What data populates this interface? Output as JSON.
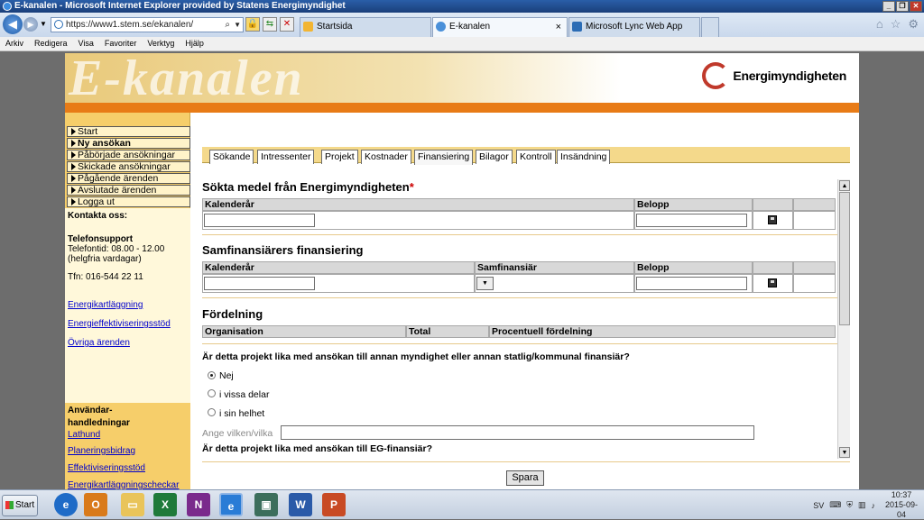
{
  "window": {
    "title": "E-kanalen - Microsoft Internet Explorer provided by Statens Energimyndighet",
    "min": "_",
    "restore": "❐",
    "close": "✕"
  },
  "browser": {
    "address": "https://www1.stem.se/ekanalen/",
    "tabs": [
      {
        "label": "Startsida"
      },
      {
        "label": "E-kanalen",
        "close": "×"
      },
      {
        "label": "Microsoft Lync Web App"
      }
    ],
    "menu": [
      "Arkiv",
      "Redigera",
      "Visa",
      "Favoriter",
      "Verktyg",
      "Hjälp"
    ]
  },
  "site": {
    "banner_title": "E-kanalen",
    "logo_text": "Energimyndigheten"
  },
  "sidebar": {
    "nav": [
      {
        "label": "Start",
        "bold": false
      },
      {
        "label": "Ny ansökan",
        "bold": true
      },
      {
        "label": "Påbörjade ansökningar",
        "bold": false
      },
      {
        "label": "Skickade ansökningar",
        "bold": false
      },
      {
        "label": "Pågående ärenden",
        "bold": false
      },
      {
        "label": "Avslutade ärenden",
        "bold": false
      },
      {
        "label": "Logga ut",
        "bold": false
      }
    ],
    "contact_title": "Kontakta oss:",
    "support_title": "Telefonsupport",
    "support_hours_1": "Telefontid: 08.00 - 12.00",
    "support_hours_2": "(helgfria vardagar)",
    "phone": "Tfn: 016-544 22 11",
    "links": [
      "Energikartläggning",
      "Energieffektiviseringsstöd",
      "Övriga ärenden"
    ],
    "manuals_title_1": "Användar-",
    "manuals_title_2": "handledningar",
    "manuals": [
      "Lathund",
      "Planeringsbidrag",
      "Effektiviseringsstöd",
      "Energikartläggningscheckar"
    ]
  },
  "tabs": [
    "Sökande",
    "Intressenter",
    "Projekt",
    "Kostnader",
    "Finansiering",
    "Bilagor",
    "Kontroll",
    "Insändning"
  ],
  "active_tab": "Finansiering",
  "form": {
    "section1": {
      "title": "Sökta medel från Energimyndigheten",
      "required_mark": "*",
      "col_year": "Kalenderår",
      "col_amount": "Belopp"
    },
    "section2": {
      "title": "Samfinansiärers finansiering",
      "col_year": "Kalenderår",
      "col_cofinancier": "Samfinansiär",
      "col_amount": "Belopp"
    },
    "section3": {
      "title": "Fördelning",
      "col_org": "Organisation",
      "col_total": "Total",
      "col_percent": "Procentuell fördelning"
    },
    "question1": "Är detta projekt lika med ansökan till annan myndighet eller annan statlig/kommunal finansiär?",
    "options": [
      "Nej",
      "i vissa delar",
      "i sin helhet"
    ],
    "selected_option": "Nej",
    "specify_label": "Ange vilken/vilka",
    "specify_value": "",
    "question2": "Är detta projekt lika med ansökan till EG-finansiär?",
    "save_label": "Spara"
  },
  "taskbar": {
    "start_label": "Start",
    "lang": "SV",
    "time": "10:37",
    "date": "2015-09-04"
  }
}
